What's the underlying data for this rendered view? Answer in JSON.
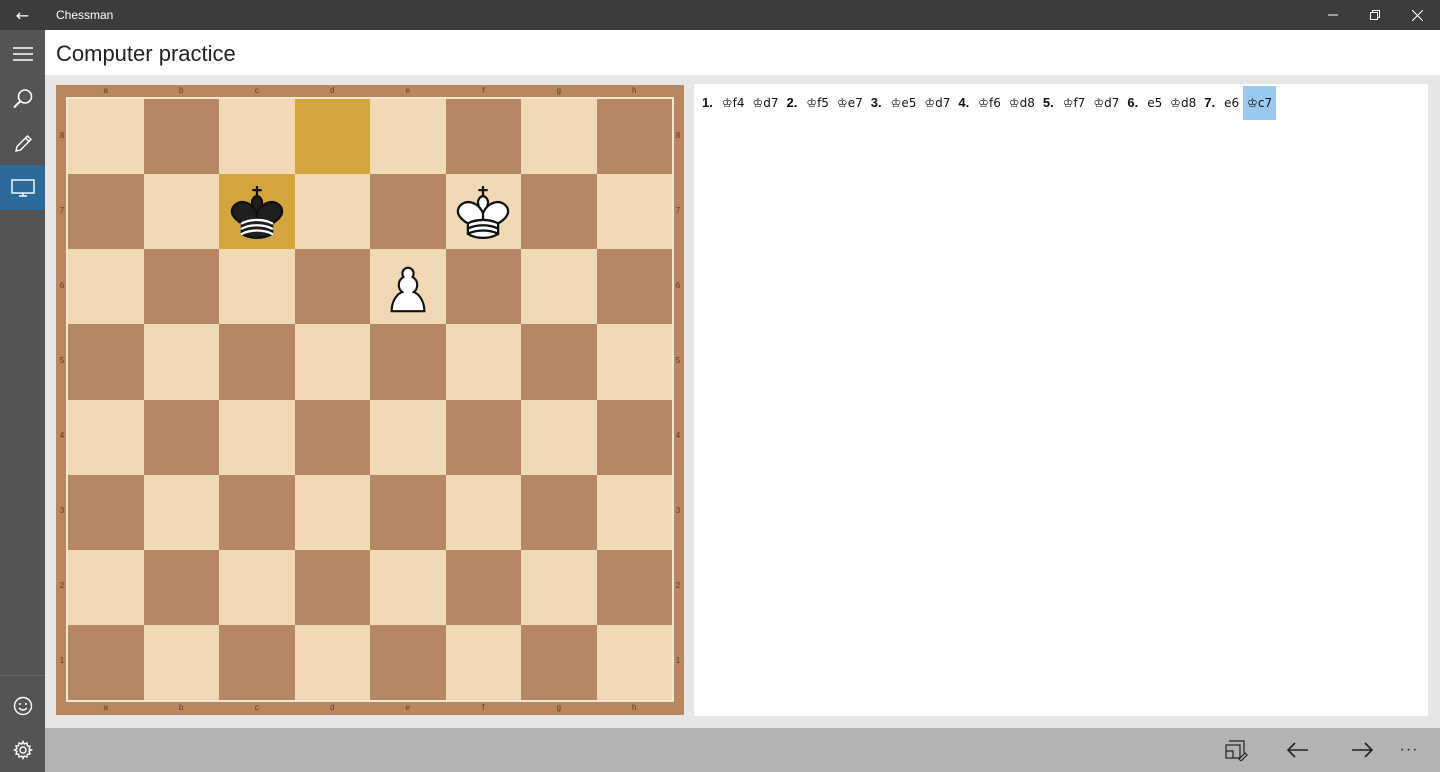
{
  "titlebar": {
    "app_title": "Chessman",
    "back_glyph": "←",
    "minimize_glyph": "—",
    "restore_glyph": "❐",
    "close_glyph": "✕"
  },
  "nav": {
    "items": [
      {
        "name": "menu",
        "icon": "hamburger-menu-icon"
      },
      {
        "name": "search",
        "icon": "search-icon"
      },
      {
        "name": "edit",
        "icon": "pencil-icon"
      },
      {
        "name": "computer-practice",
        "icon": "monitor-icon",
        "active": true
      }
    ],
    "bottom_items": [
      {
        "name": "feedback",
        "icon": "smiley-icon"
      },
      {
        "name": "settings",
        "icon": "gear-icon"
      }
    ]
  },
  "page": {
    "title": "Computer practice"
  },
  "board": {
    "files": [
      "a",
      "b",
      "c",
      "d",
      "e",
      "f",
      "g",
      "h"
    ],
    "ranks": [
      "8",
      "7",
      "6",
      "5",
      "4",
      "3",
      "2",
      "1"
    ],
    "highlighted": [
      "d8",
      "c7"
    ],
    "pieces": [
      {
        "square": "c7",
        "type": "king",
        "color": "black"
      },
      {
        "square": "f7",
        "type": "king",
        "color": "white"
      },
      {
        "square": "e6",
        "type": "pawn",
        "color": "white"
      }
    ],
    "colors": {
      "light": "#f0dab5",
      "dark": "#b58863",
      "highlight": "#d3a53f",
      "frame": "#b8875f"
    }
  },
  "moves": [
    {
      "text": "1.",
      "kind": "num"
    },
    {
      "text": "♔f4",
      "kind": "move"
    },
    {
      "text": "♔d7",
      "kind": "move"
    },
    {
      "text": "2.",
      "kind": "num"
    },
    {
      "text": "♔f5",
      "kind": "move"
    },
    {
      "text": "♔e7",
      "kind": "move"
    },
    {
      "text": "3.",
      "kind": "num"
    },
    {
      "text": "♔e5",
      "kind": "move"
    },
    {
      "text": "♔d7",
      "kind": "move"
    },
    {
      "text": "4.",
      "kind": "num"
    },
    {
      "text": "♔f6",
      "kind": "move"
    },
    {
      "text": "♔d8",
      "kind": "move"
    },
    {
      "text": "5.",
      "kind": "num"
    },
    {
      "text": "♔f7",
      "kind": "move"
    },
    {
      "text": "♔d7",
      "kind": "move"
    },
    {
      "text": "6.",
      "kind": "num"
    },
    {
      "text": "e5",
      "kind": "move"
    },
    {
      "text": "♔d8",
      "kind": "move"
    },
    {
      "text": "7.",
      "kind": "num"
    },
    {
      "text": "e6",
      "kind": "move"
    },
    {
      "text": "♔c7",
      "kind": "move",
      "selected": true
    }
  ],
  "commands": [
    {
      "name": "board-position",
      "icon": "board-edit-icon"
    },
    {
      "name": "previous-move",
      "icon": "arrow-left-icon"
    },
    {
      "name": "next-move",
      "icon": "arrow-right-icon"
    },
    {
      "name": "more",
      "icon": "more-ellipsis-icon",
      "glyph": "···"
    }
  ],
  "accent_color": "#2b6a99",
  "selection_color": "#99c9ef"
}
